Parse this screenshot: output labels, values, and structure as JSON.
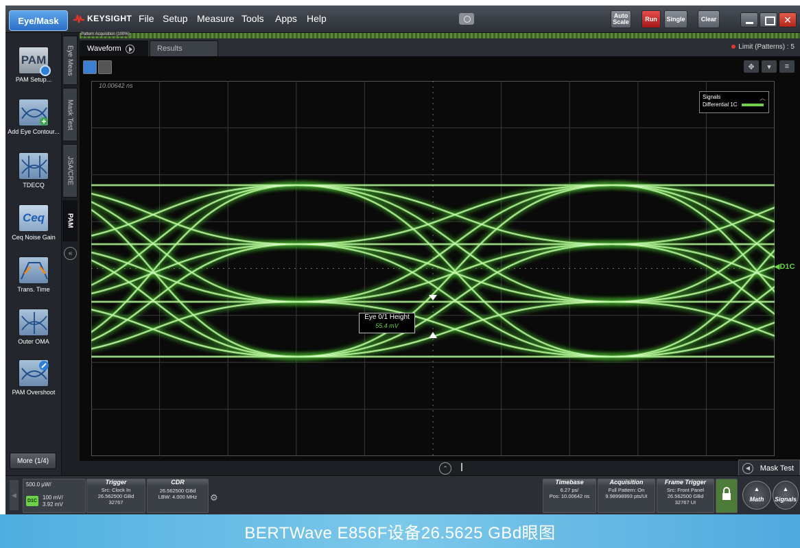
{
  "app": {
    "mode_button": "Eye/Mask",
    "brand": "KEYSIGHT",
    "menu": [
      "File",
      "Setup",
      "Measure",
      "Tools",
      "Apps",
      "Help"
    ],
    "toolbar": {
      "auto_scale": "Auto Scale",
      "run": "Run",
      "single": "Single",
      "clear": "Clear"
    }
  },
  "left_panel": {
    "tools": [
      {
        "label": "PAM Setup...",
        "icon": "pam-icon"
      },
      {
        "label": "Add Eye Contour...",
        "icon": "add-eye-contour-icon"
      },
      {
        "label": "TDECQ",
        "icon": "tdecq-icon"
      },
      {
        "label": "Ceq Noise Gain",
        "icon": "ceq-icon"
      },
      {
        "label": "Trans. Time",
        "icon": "transition-time-icon"
      },
      {
        "label": "Outer OMA",
        "icon": "outer-oma-icon"
      },
      {
        "label": "PAM Overshoot",
        "icon": "pam-overshoot-icon"
      }
    ],
    "pam_icon_text": "PAM",
    "ceq_icon_text": "Ceq",
    "more_button": "More (1/4)"
  },
  "vertical_tabs": [
    "Eye Meas",
    "Mask Test",
    "JSA/CRE",
    "PAM"
  ],
  "main": {
    "status_strip": "Pattern Acquisition (100%)",
    "tabs": [
      "Waveform",
      "Results"
    ],
    "limit_text": "Limit (Patterns) : 5",
    "time_position": "10.00642 ns",
    "legend": {
      "title": "Signals",
      "entry": "Differential 1C",
      "color": "#6ed14c"
    },
    "channel_marker": "◀D1C",
    "measurement": {
      "label": "Eye 0/1 Height",
      "value": "55.4 mV"
    },
    "mask_test_tab": "Mask Test"
  },
  "bottom": {
    "channel": {
      "scale_top": "500.0 µW/",
      "badge": "D1C",
      "scale_mv": "100 mV/",
      "offset": "3.92 mV"
    },
    "trigger": {
      "title": "Trigger",
      "line1": "Src: Clock In",
      "line2": "26.562500 GBd",
      "line3": "32767"
    },
    "cdr": {
      "title": "CDR",
      "line1": "26.562500 GBd",
      "line2": "LBW: 4.000 MHz"
    },
    "timebase": {
      "title": "Timebase",
      "line1": "6.27 ps/",
      "line2": "Pos: 10.00642 ns"
    },
    "acquisition": {
      "title": "Acquisition",
      "line1": "Full Pattern: On",
      "line2": "9.98998993 pts/UI"
    },
    "frame_trigger": {
      "title": "Frame Trigger",
      "line1": "Src: Front Panel",
      "line2": "26.562500 GBd",
      "line3": "32767 UI"
    },
    "math_button": "Math",
    "signals_button": "Signals"
  },
  "caption": "BERTWave E856F设备26.5625 GBd眼图"
}
